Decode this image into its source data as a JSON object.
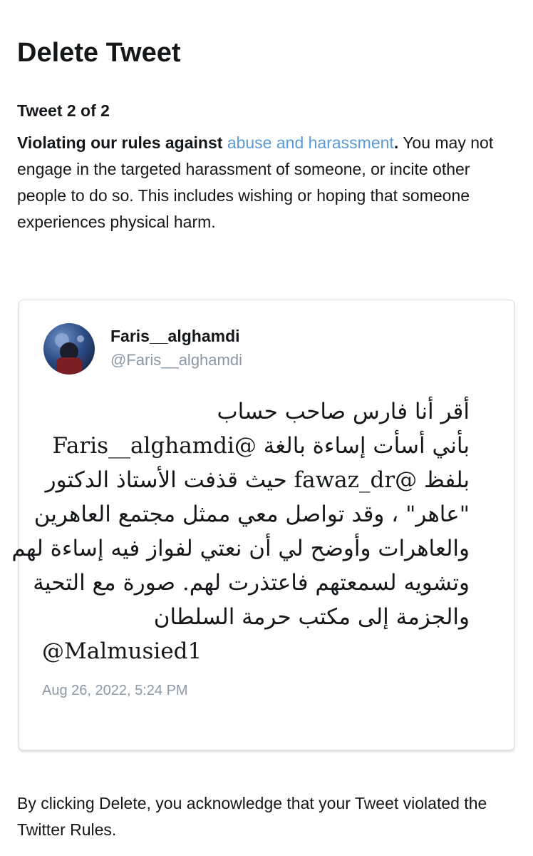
{
  "title": "Delete Tweet",
  "counter": "Tweet 2 of 2",
  "violation": {
    "lead": "Violating our rules against ",
    "link": "abuse and harassment",
    "period": ".",
    "description": "You may not engage in the targeted harassment of someone, or incite other people to do so. This includes wishing or hoping that someone experiences physical harm."
  },
  "tweet": {
    "display_name": "Faris__alghamdi",
    "handle": "@Faris__alghamdi",
    "lines": [
      "أقر أنا فارس صاحب حساب",
      "بأني أسأت إساءة بالغة @Faris__alghamdi",
      "بلفظ @fawaz_dr حيث قذفت الأستاذ الدكتور",
      "\"عاهر\" ، وقد تواصل معي ممثل مجتمع العاهرين",
      "والعاهرات وأوضح لي أن نعتي لفواز فيه إساءة لهم",
      "وتشويه لسمعتهم فاعتذرت لهم. صورة مع التحية",
      "والجزمة إلى مكتب حرمة السلطان",
      "@Malmusied1"
    ],
    "timestamp": "Aug 26, 2022, 5:24 PM"
  },
  "footer": "By clicking Delete, you acknowledge that your Tweet violated the Twitter Rules."
}
